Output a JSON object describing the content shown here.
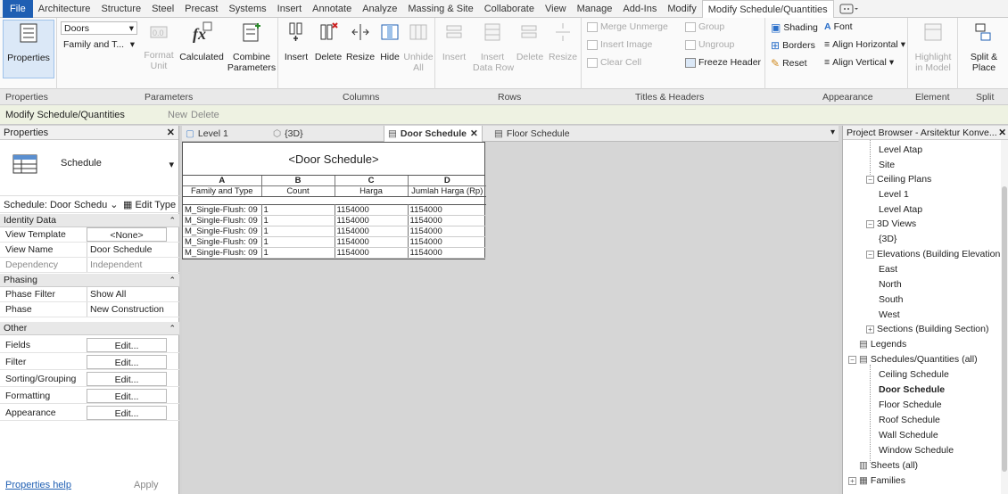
{
  "menu_tabs": [
    "File",
    "Architecture",
    "Structure",
    "Steel",
    "Precast",
    "Systems",
    "Insert",
    "Annotate",
    "Analyze",
    "Massing & Site",
    "Collaborate",
    "View",
    "Manage",
    "Add-Ins",
    "Modify",
    "Modify Schedule/Quantities"
  ],
  "active_tab": "Modify Schedule/Quantities",
  "ribbon": {
    "properties": "Properties",
    "category_select": "Doors",
    "family_select": "Family and T...",
    "format_unit": "Format\nUnit",
    "calculated": "Calculated",
    "combine": "Combine\nParameters",
    "insert": "Insert",
    "delete": "Delete",
    "resize": "Resize",
    "hide": "Hide",
    "unhide_all": "Unhide\nAll",
    "rows_insert": "Insert",
    "rows_insert_data": "Insert\nData Row",
    "rows_delete": "Delete",
    "rows_resize": "Resize",
    "merge_unmerge": "Merge Unmerge",
    "insert_image": "Insert Image",
    "clear_cell": "Clear Cell",
    "group": "Group",
    "ungroup": "Ungroup",
    "freeze_header": "Freeze Header",
    "shading": "Shading",
    "borders": "Borders",
    "reset": "Reset",
    "font": "Font",
    "align_horizontal": "Align Horizontal",
    "align_vertical": "Align Vertical",
    "highlight_in_model": "Highlight\nin Model",
    "split_place": "Split &\nPlace"
  },
  "panel_titles": {
    "properties": "Properties",
    "parameters": "Parameters",
    "columns": "Columns",
    "rows": "Rows",
    "titles_headers": "Titles & Headers",
    "appearance": "Appearance",
    "element": "Element",
    "split": "Split"
  },
  "context_bar": {
    "title": "Modify Schedule/Quantities",
    "new": "New",
    "delete": "Delete"
  },
  "properties_palette": {
    "title": "Properties",
    "type_name": "Schedule",
    "instance_selector": "Schedule: Door Schedu",
    "edit_type": "Edit Type",
    "groups": [
      {
        "name": "Identity Data",
        "rows": [
          {
            "key": "View Template",
            "value": "<None>",
            "button": true
          },
          {
            "key": "View Name",
            "value": "Door Schedule"
          },
          {
            "key": "Dependency",
            "value": "Independent",
            "disabled": true
          }
        ]
      },
      {
        "name": "Phasing",
        "rows": [
          {
            "key": "Phase Filter",
            "value": "Show All"
          },
          {
            "key": "Phase",
            "value": "New Construction"
          }
        ]
      },
      {
        "name": "Other",
        "rows": [
          {
            "key": "Fields",
            "value": "Edit...",
            "button": true
          },
          {
            "key": "Filter",
            "value": "Edit...",
            "button": true
          },
          {
            "key": "Sorting/Grouping",
            "value": "Edit...",
            "button": true
          },
          {
            "key": "Formatting",
            "value": "Edit...",
            "button": true
          },
          {
            "key": "Appearance",
            "value": "Edit...",
            "button": true
          }
        ]
      }
    ],
    "help_link": "Properties help",
    "apply": "Apply"
  },
  "view_tabs": [
    {
      "label": "Level 1"
    },
    {
      "label": "{3D}"
    },
    {
      "label": "Door Schedule",
      "active": true
    },
    {
      "label": "Floor Schedule"
    }
  ],
  "schedule": {
    "title": "<Door Schedule>",
    "letters": [
      "A",
      "B",
      "C",
      "D"
    ],
    "headers": [
      "Family and Type",
      "Count",
      "Harga",
      "Jumlah Harga (Rp)"
    ],
    "rows": [
      [
        "M_Single-Flush: 09",
        "1",
        "1154000",
        "1154000"
      ],
      [
        "M_Single-Flush: 09",
        "1",
        "1154000",
        "1154000"
      ],
      [
        "M_Single-Flush: 09",
        "1",
        "1154000",
        "1154000"
      ],
      [
        "M_Single-Flush: 09",
        "1",
        "1154000",
        "1154000"
      ],
      [
        "M_Single-Flush: 09",
        "1",
        "1154000",
        "1154000"
      ]
    ]
  },
  "project_browser": {
    "title": "Project Browser - Arsitektur Konve...",
    "items": [
      {
        "label": "Level Atap",
        "indent": 3
      },
      {
        "label": "Site",
        "indent": 3
      },
      {
        "label": "Ceiling Plans",
        "indent": 2,
        "expander": "minus"
      },
      {
        "label": "Level 1",
        "indent": 3
      },
      {
        "label": "Level Atap",
        "indent": 3
      },
      {
        "label": "3D Views",
        "indent": 2,
        "expander": "minus"
      },
      {
        "label": "{3D}",
        "indent": 3
      },
      {
        "label": "Elevations (Building Elevation",
        "indent": 2,
        "expander": "minus"
      },
      {
        "label": "East",
        "indent": 3
      },
      {
        "label": "North",
        "indent": 3
      },
      {
        "label": "South",
        "indent": 3
      },
      {
        "label": "West",
        "indent": 3
      },
      {
        "label": "Sections (Building Section)",
        "indent": 2,
        "expander": "plus"
      },
      {
        "label": "Legends",
        "indent": 1,
        "icon": true
      },
      {
        "label": "Schedules/Quantities (all)",
        "indent": 1,
        "icon": true,
        "expander": "minus"
      },
      {
        "label": "Ceiling Schedule",
        "indent": 2
      },
      {
        "label": "Door Schedule",
        "indent": 2,
        "bold": true
      },
      {
        "label": "Floor Schedule",
        "indent": 2
      },
      {
        "label": "Roof Schedule",
        "indent": 2
      },
      {
        "label": "Wall Schedule",
        "indent": 2
      },
      {
        "label": "Window Schedule",
        "indent": 2
      },
      {
        "label": "Sheets (all)",
        "indent": 1,
        "icon": true
      },
      {
        "label": "Families",
        "indent": 1,
        "icon": true,
        "expander": "plus"
      }
    ]
  },
  "colors": {
    "file_tab": "#1f5fb3",
    "context_bar": "#eef2e2",
    "canvas": "#d6d6d6"
  }
}
